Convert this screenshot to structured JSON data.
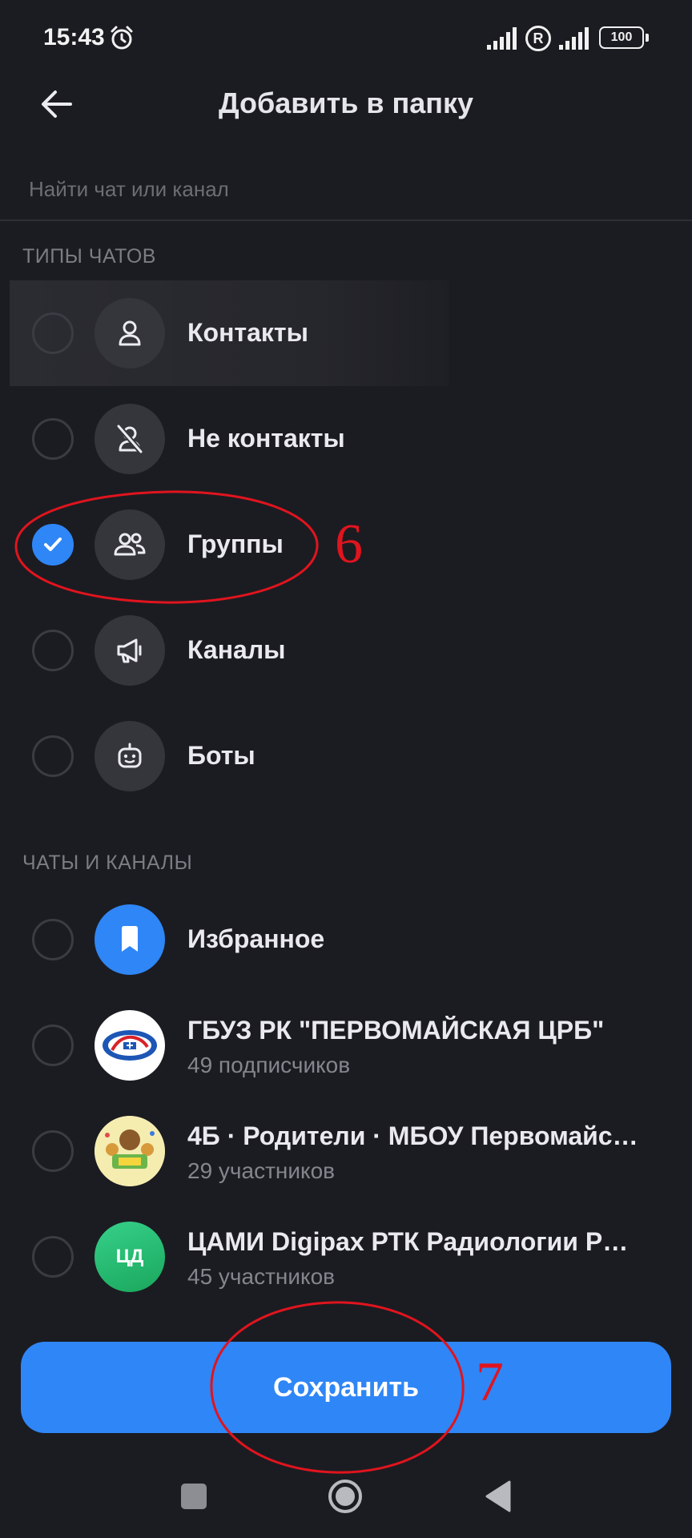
{
  "status_bar": {
    "time": "15:43",
    "battery": "100",
    "roaming": "R"
  },
  "header": {
    "title": "Добавить в папку"
  },
  "search": {
    "placeholder": "Найти чат или канал"
  },
  "chat_types": {
    "header": "ТИПЫ ЧАТОВ",
    "items": [
      {
        "label": "Контакты",
        "icon": "person-icon",
        "checked": false
      },
      {
        "label": "Не контакты",
        "icon": "person-off-icon",
        "checked": false
      },
      {
        "label": "Группы",
        "icon": "group-icon",
        "checked": true
      },
      {
        "label": "Каналы",
        "icon": "megaphone-icon",
        "checked": false
      },
      {
        "label": "Боты",
        "icon": "bot-icon",
        "checked": false
      }
    ]
  },
  "chats": {
    "header": "ЧАТЫ И КАНАЛЫ",
    "items": [
      {
        "title": "Избранное",
        "subtitle": "",
        "avatar": "bookmark-icon"
      },
      {
        "title": "ГБУЗ РК \"ПЕРВОМАЙСКАЯ ЦРБ\"",
        "subtitle": "49 подписчиков",
        "avatar": "crb-logo"
      },
      {
        "title": "4Б · Родители · МБОУ Первомайс…",
        "subtitle": "29 участников",
        "avatar": "class-4b-image"
      },
      {
        "title": "ЦАМИ Digipax РТК Радиологии Р…",
        "subtitle": "45 участников",
        "avatar": "initials",
        "initials": "ЦД"
      }
    ]
  },
  "save_button": {
    "label": "Сохранить"
  },
  "annotations": {
    "first": "6",
    "second": "7"
  },
  "colors": {
    "background": "#1b1c21",
    "accent": "#2f86f6",
    "annotation": "#e0141e",
    "avatar_green": "#1fb86b"
  }
}
